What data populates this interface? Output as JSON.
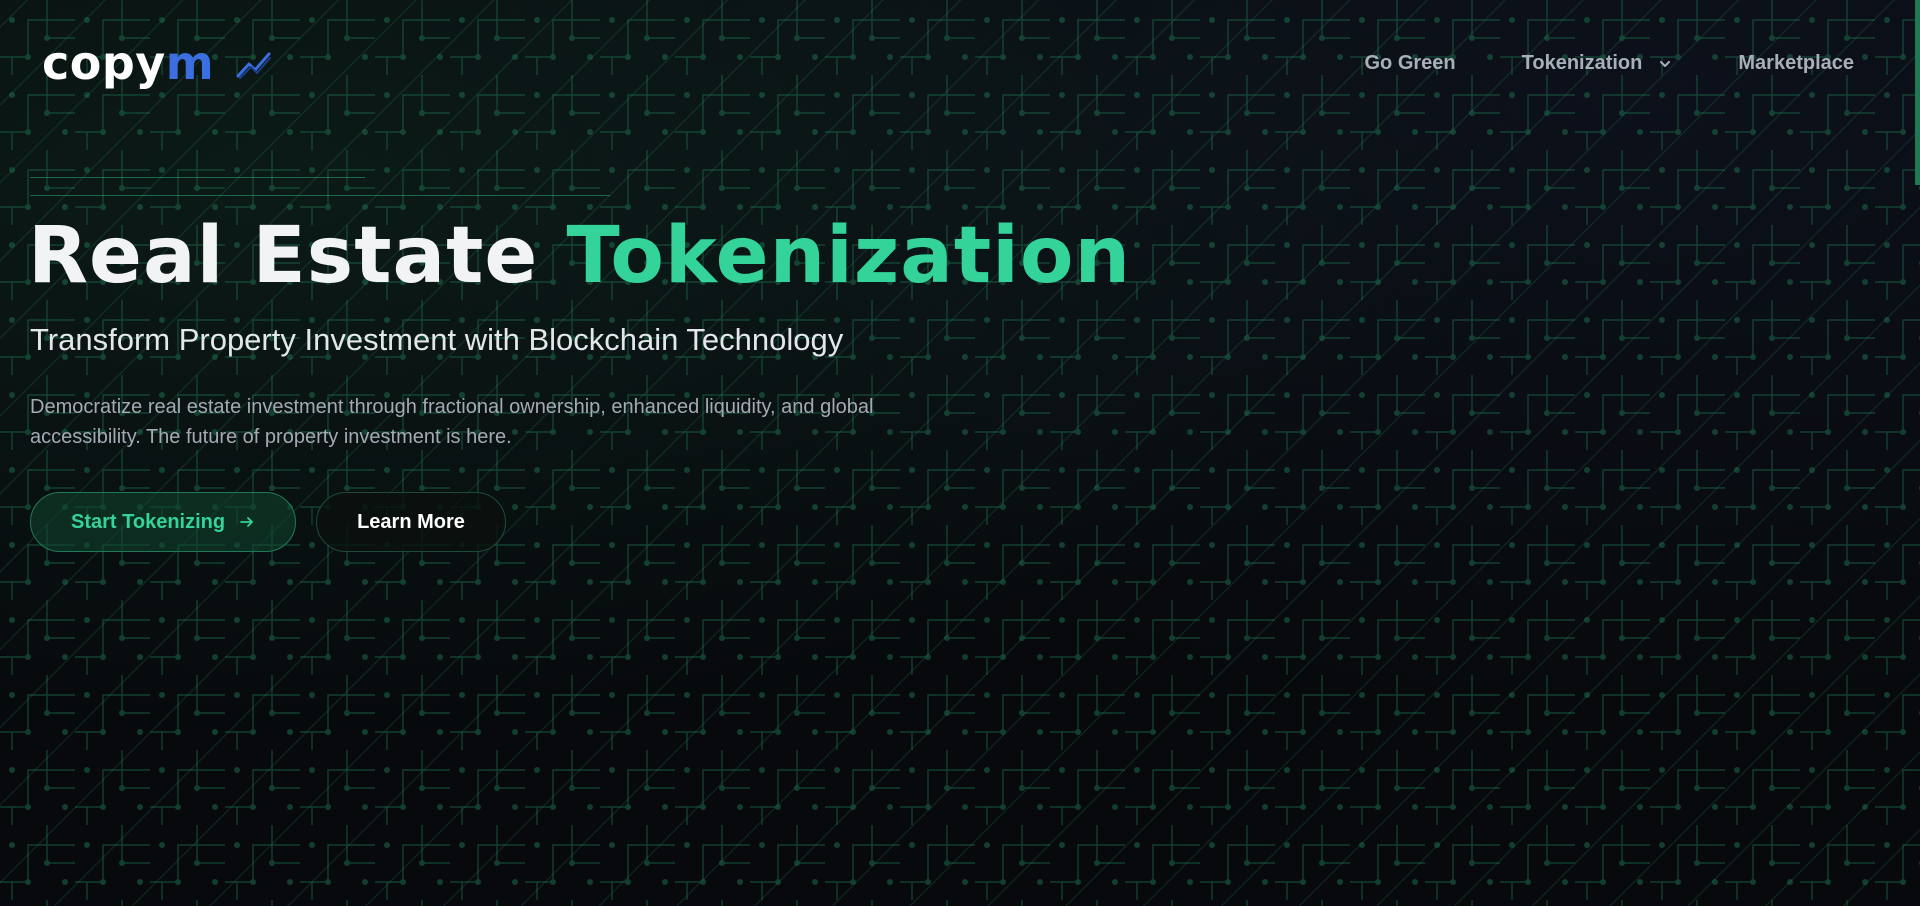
{
  "header": {
    "logo": {
      "text_main": "copy",
      "text_accent": "m",
      "icon": "trend-line-icon"
    },
    "nav": [
      {
        "label": "Go Green",
        "has_dropdown": false
      },
      {
        "label": "Tokenization",
        "has_dropdown": true,
        "icon": "chevron-down-icon"
      },
      {
        "label": "Marketplace",
        "has_dropdown": false
      }
    ]
  },
  "hero": {
    "title_part1": "Real Estate",
    "title_part2": "Tokenization",
    "subtitle": "Transform Property Investment with Blockchain Technology",
    "description": "Democratize real estate investment through fractional ownership, enhanced liquidity, and global accessibility. The future of property investment is here.",
    "primary_button": {
      "label": "Start Tokenizing",
      "icon": "arrow-right-icon"
    },
    "secondary_button": {
      "label": "Learn More"
    }
  },
  "colors": {
    "accent_green": "#34d399",
    "logo_blue": "#3b6fe0",
    "background": "#07090c"
  }
}
